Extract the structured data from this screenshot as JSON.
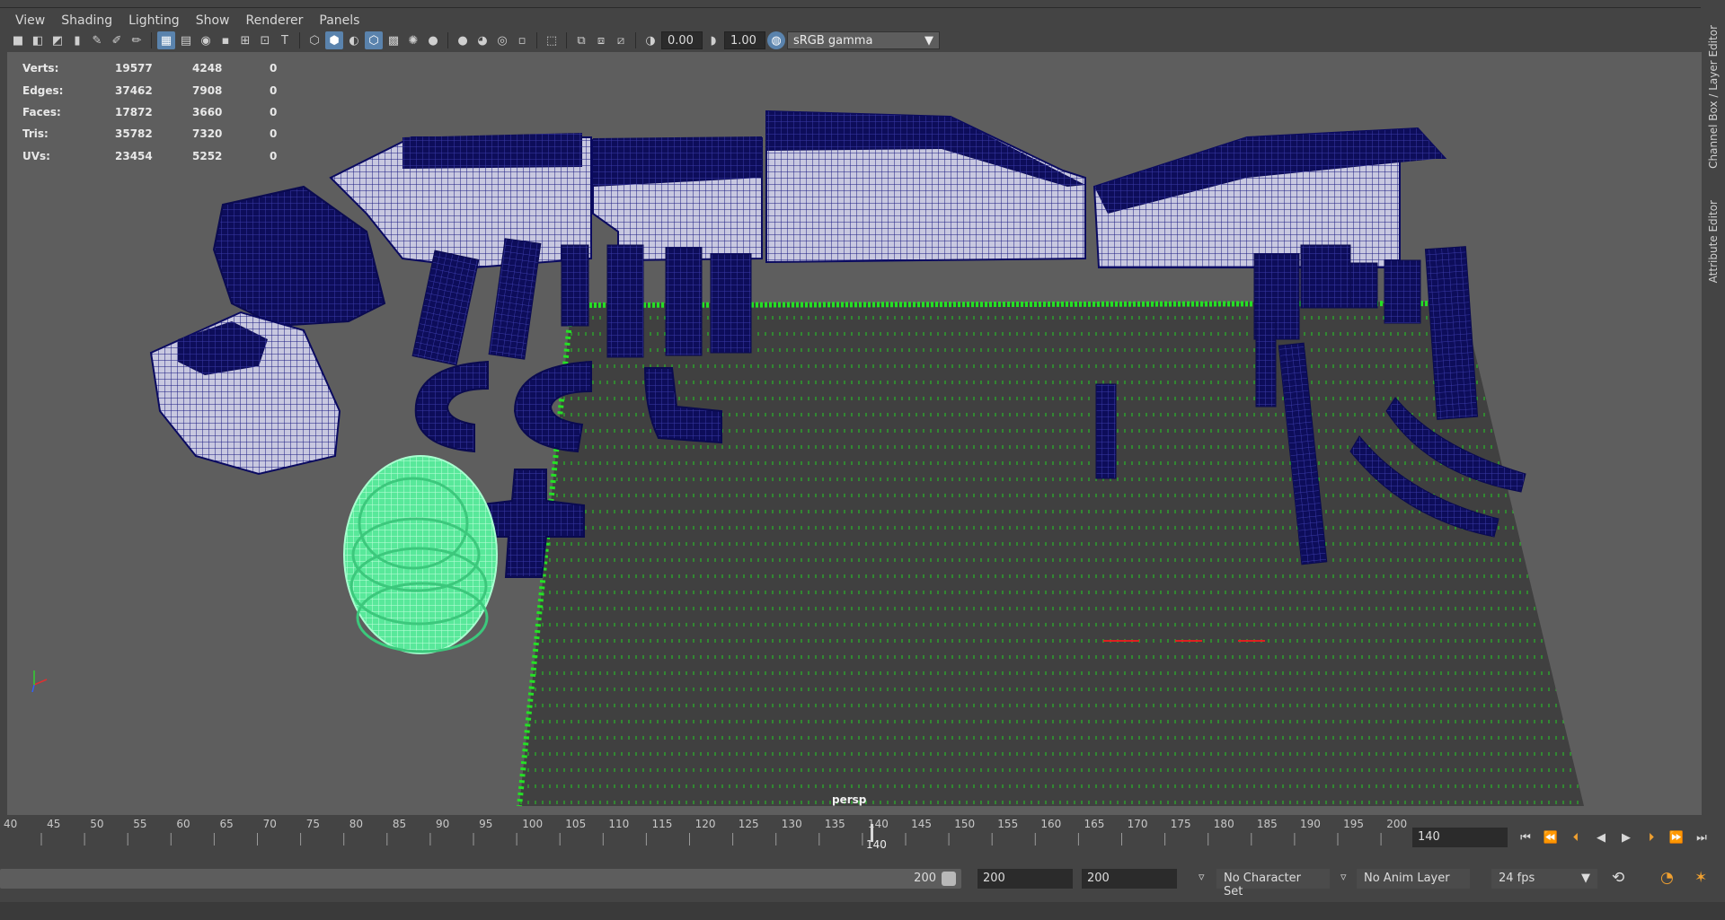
{
  "menu": [
    "View",
    "Shading",
    "Lighting",
    "Show",
    "Renderer",
    "Panels"
  ],
  "toolbar": {
    "exposure": "0.00",
    "gamma": "1.00",
    "color_space": "sRGB gamma"
  },
  "hud": {
    "rows": [
      {
        "label": "Verts:",
        "a": "19577",
        "b": "4248",
        "c": "0"
      },
      {
        "label": "Edges:",
        "a": "37462",
        "b": "7908",
        "c": "0"
      },
      {
        "label": "Faces:",
        "a": "17872",
        "b": "3660",
        "c": "0"
      },
      {
        "label": "Tris:",
        "a": "35782",
        "b": "7320",
        "c": "0"
      },
      {
        "label": "UVs:",
        "a": "23454",
        "b": "5252",
        "c": "0"
      }
    ]
  },
  "camera_label": "persp",
  "side_tabs": {
    "channel_box": "Channel Box / Layer Editor",
    "attribute_editor": "Attribute Editor"
  },
  "timeline": {
    "ticks": [
      "40",
      "45",
      "50",
      "55",
      "60",
      "65",
      "70",
      "75",
      "80",
      "85",
      "90",
      "95",
      "100",
      "105",
      "110",
      "115",
      "120",
      "125",
      "130",
      "135",
      "140",
      "145",
      "150",
      "155",
      "160",
      "165",
      "170",
      "175",
      "180",
      "185",
      "190",
      "195",
      "200"
    ],
    "current_frame": "140",
    "current_frame_field": "140"
  },
  "range": {
    "slider_end": "200",
    "start_field": "200",
    "end_field": "200",
    "character_set": "No Character Set",
    "anim_layer": "No Anim Layer",
    "fps": "24 fps"
  },
  "colors": {
    "selected_mesh": "#5cf0a0",
    "mesh_wire": "#1a1a7a",
    "grid_numbers": "#27e027",
    "viewport_bg": "#5e5e5e"
  }
}
